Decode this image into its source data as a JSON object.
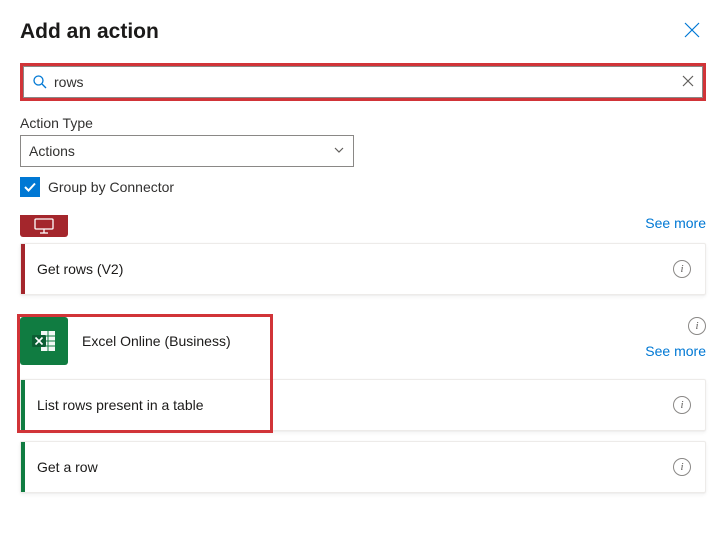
{
  "header": {
    "title": "Add an action"
  },
  "search": {
    "value": "rows"
  },
  "actionType": {
    "label": "Action Type",
    "selected": "Actions"
  },
  "groupBy": {
    "label": "Group by Connector",
    "checked": true
  },
  "links": {
    "seeMore": "See more"
  },
  "groups": [
    {
      "actions": [
        {
          "label": "Get rows (V2)"
        }
      ]
    },
    {
      "connectorTitle": "Excel Online (Business)",
      "actions": [
        {
          "label": "List rows present in a table"
        },
        {
          "label": "Get a row"
        }
      ]
    }
  ]
}
